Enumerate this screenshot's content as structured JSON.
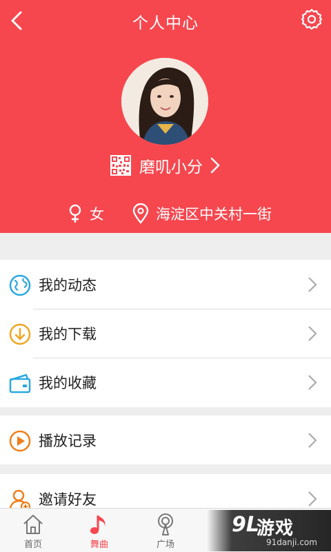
{
  "header": {
    "title": "个人中心",
    "back_icon": "back-chevron-icon",
    "settings_icon": "gear-icon",
    "background_color": "#f6474f"
  },
  "profile": {
    "name": "磨叽小分",
    "gender": "女",
    "location": "海淀区中关村一街"
  },
  "menu_group_1": [
    {
      "label": "我的动态",
      "icon": "globe-icon",
      "icon_color": "#2aa8e0"
    },
    {
      "label": "我的下载",
      "icon": "download-icon",
      "icon_color": "#f0a520"
    },
    {
      "label": "我的收藏",
      "icon": "wallet-icon",
      "icon_color": "#2aa8e0"
    }
  ],
  "menu_group_2": [
    {
      "label": "播放记录",
      "icon": "play-icon",
      "icon_color": "#f07e1a"
    }
  ],
  "menu_group_3": [
    {
      "label": "邀请好友",
      "icon": "add-user-icon",
      "icon_color": "#f07e1a"
    }
  ],
  "tabbar": {
    "tabs": [
      {
        "label": "首页",
        "icon": "home-icon",
        "active": false
      },
      {
        "label": "舞曲",
        "icon": "music-note-icon",
        "active": true
      },
      {
        "label": "广场",
        "icon": "broadcast-icon",
        "active": false
      }
    ],
    "active_color": "#f6474f"
  },
  "watermark": {
    "logo": "9L",
    "text": "游戏",
    "sub": "91danji.com"
  }
}
